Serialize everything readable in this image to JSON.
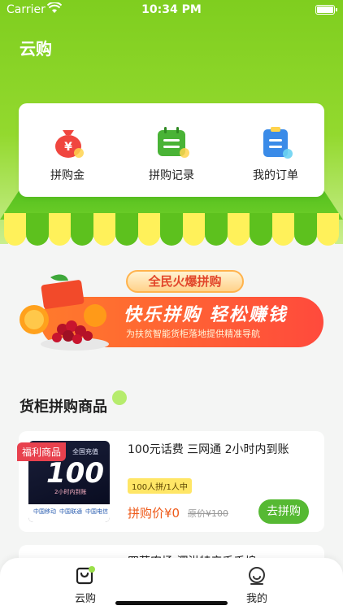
{
  "status_bar": {
    "carrier": "Carrier",
    "time": "10:34 PM"
  },
  "header": {
    "title": "云购"
  },
  "quick_actions": [
    {
      "label": "拼购金",
      "icon": "money-bag-icon",
      "color": "#f0463f"
    },
    {
      "label": "拼购记录",
      "icon": "calendar-record-icon",
      "color": "#49b336"
    },
    {
      "label": "我的订单",
      "icon": "clipboard-order-icon",
      "color": "#3a8be8"
    }
  ],
  "banner": {
    "tag": "全民火爆拼购",
    "headline": "快乐拼购 轻松赚钱",
    "subline": "为扶贫智能货柜落地提供精准导航"
  },
  "section": {
    "title": "货柜拼购商品"
  },
  "products": [
    {
      "tag": "福利商品",
      "title": "100元话费 三网通 2小时内到账",
      "badge": "100人拼/1人中",
      "price": "拼购价¥0",
      "original_price": "原价¥100",
      "button": "去拼购",
      "image_text": {
        "top": "全国充值",
        "value": "100",
        "sub": "2小时内到账",
        "logos": [
          "中国移动",
          "中国联通",
          "中国电信"
        ]
      }
    },
    {
      "title": "四菜农场 泗洪特产千禾埠"
    }
  ],
  "tabbar": [
    {
      "label": "云购",
      "icon": "shopping-bag-icon",
      "active": true
    },
    {
      "label": "我的",
      "icon": "profile-face-icon",
      "active": false
    }
  ],
  "colors": {
    "brand_green": "#7fce1f",
    "price_orange": "#ee5a1a",
    "button_green": "#56b933",
    "tag_red": "#e8414e"
  }
}
